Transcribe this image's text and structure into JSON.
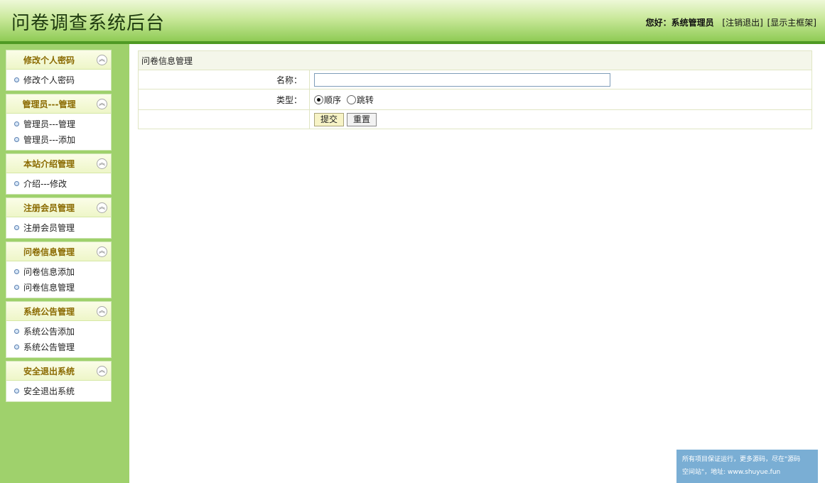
{
  "header": {
    "title": "问卷调查系统后台",
    "greeting": "您好：系统管理员",
    "logout": "[注销退出]",
    "show_frame": "[显示主框架]"
  },
  "sidebar": {
    "groups": [
      {
        "title": "修改个人密码",
        "items": [
          "修改个人密码"
        ]
      },
      {
        "title": "管理员---管理",
        "items": [
          "管理员---管理",
          "管理员---添加"
        ]
      },
      {
        "title": "本站介绍管理",
        "items": [
          "介绍---修改"
        ]
      },
      {
        "title": "注册会员管理",
        "items": [
          "注册会员管理"
        ]
      },
      {
        "title": "问卷信息管理",
        "items": [
          "问卷信息添加",
          "问卷信息管理"
        ]
      },
      {
        "title": "系统公告管理",
        "items": [
          "系统公告添加",
          "系统公告管理"
        ]
      },
      {
        "title": "安全退出系统",
        "items": [
          "安全退出系统"
        ]
      }
    ]
  },
  "form": {
    "heading": "问卷信息管理",
    "name_label": "名称：",
    "name_value": "",
    "type_label": "类型：",
    "type_options": [
      "顺序",
      "跳转"
    ],
    "type_selected": "顺序",
    "submit_label": "提交",
    "reset_label": "重置"
  },
  "watermark": {
    "line1": "所有项目保证运行，更多源码，尽在\"源码",
    "line2": "空间站\"，地址: www.shuyue.fun"
  }
}
